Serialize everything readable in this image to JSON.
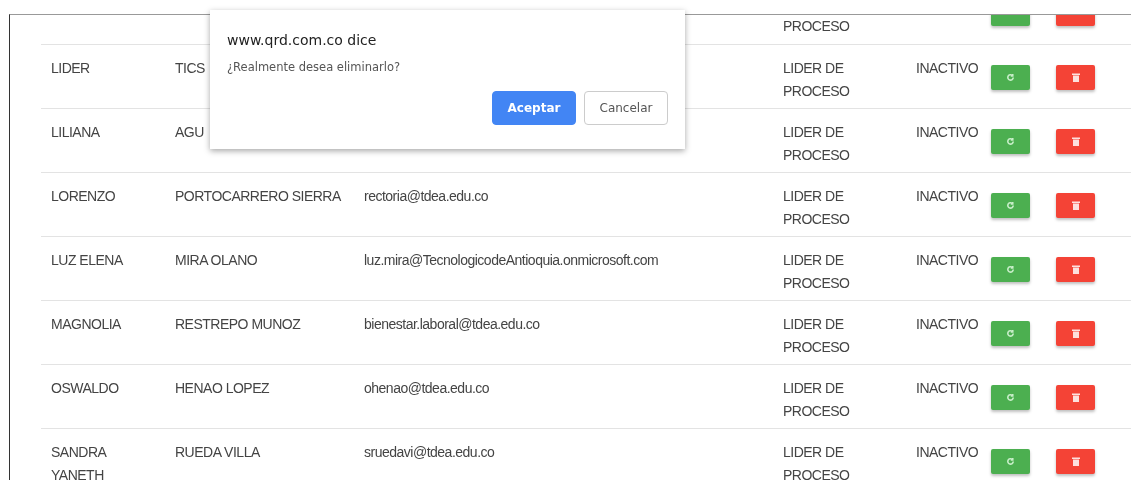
{
  "table": {
    "rows": [
      {
        "kind": "cut",
        "role": "PROCESO"
      },
      {
        "kind": "full",
        "first_name": "LIDER",
        "last_name": "TICS",
        "role": "LIDER DE PROCESO",
        "status": "INACTIVO"
      },
      {
        "kind": "full",
        "first_name": "LILIANA",
        "last_name": "AGU",
        "role": "LIDER DE PROCESO",
        "status": "INACTIVO"
      },
      {
        "kind": "full",
        "first_name": "LORENZO",
        "last_name": "PORTOCARRERO SIERRA",
        "email": "rectoria@tdea.edu.co",
        "role": "LIDER DE PROCESO",
        "status": "INACTIVO"
      },
      {
        "kind": "full",
        "first_name": "LUZ ELENA",
        "last_name": "MIRA OLANO",
        "email": "luz.mira@TecnologicodeAntioquia.onmicrosoft.com",
        "role": "LIDER DE PROCESO",
        "status": "INACTIVO"
      },
      {
        "kind": "full",
        "first_name": "MAGNOLIA",
        "last_name": "RESTREPO MUNOZ",
        "email": "bienestar.laboral@tdea.edu.co",
        "role": "LIDER DE PROCESO",
        "status": "INACTIVO"
      },
      {
        "kind": "full",
        "first_name": "OSWALDO",
        "last_name": "HENAO LOPEZ",
        "email": "ohenao@tdea.edu.co",
        "role": "LIDER DE PROCESO",
        "status": "INACTIVO"
      },
      {
        "kind": "full",
        "first_name": "SANDRA YANETH",
        "last_name": "RUEDA VILLA",
        "email": "sruedavi@tdea.edu.co",
        "role": "LIDER DE PROCESO",
        "status": "INACTIVO"
      }
    ]
  },
  "dialog": {
    "title": "www.qrd.com.co dice",
    "message": "¿Realmente desea eliminarlo?",
    "buttons": [
      "Aceptar",
      "Cancelar"
    ]
  }
}
